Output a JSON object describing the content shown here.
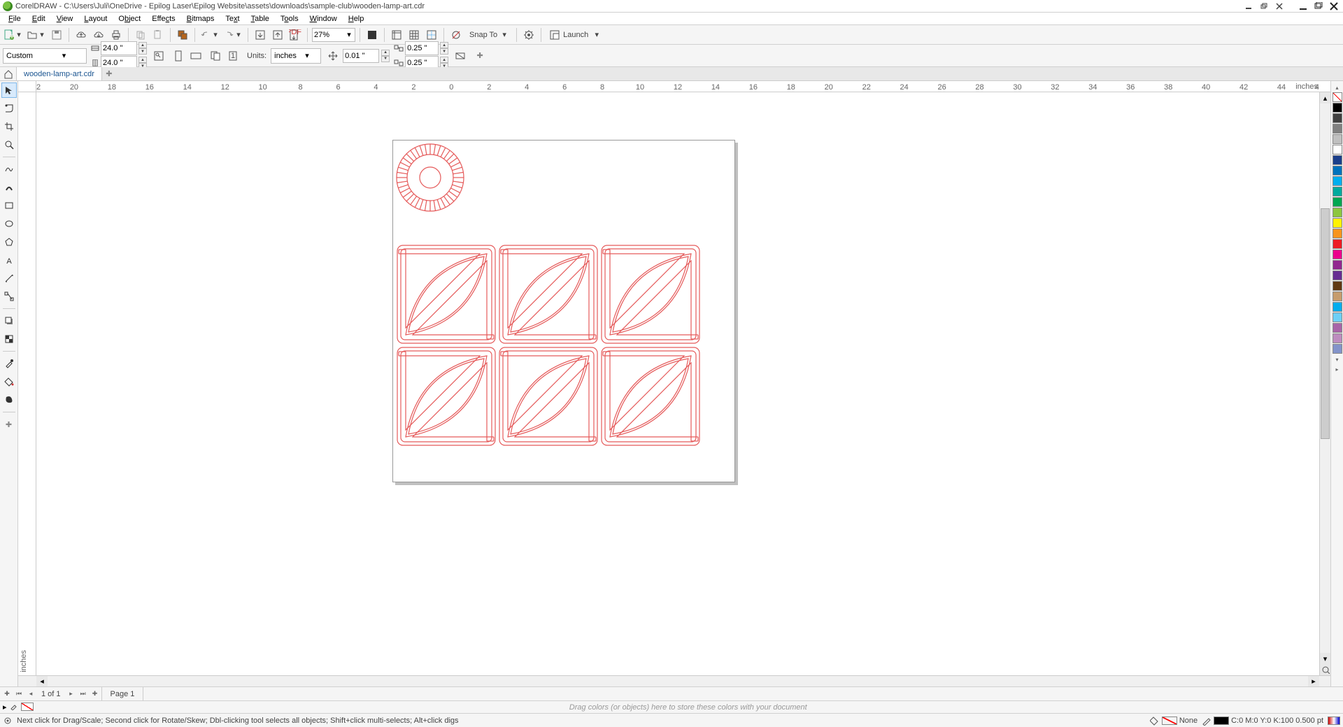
{
  "title": "CorelDRAW - C:\\Users\\Juli\\OneDrive - Epilog Laser\\Epilog Website\\assets\\downloads\\sample-club\\wooden-lamp-art.cdr",
  "menu": [
    "File",
    "Edit",
    "View",
    "Layout",
    "Object",
    "Effects",
    "Bitmaps",
    "Text",
    "Table",
    "Tools",
    "Window",
    "Help"
  ],
  "toolbar1": {
    "zoom": "27%",
    "snap": "Snap To",
    "launch": "Launch"
  },
  "toolbar2": {
    "preset": "Custom",
    "width": "24.0 \"",
    "height": "24.0 \"",
    "units_label": "Units:",
    "units": "inches",
    "nudge": "0.01 \"",
    "dupx": "0.25 \"",
    "dupy": "0.25 \""
  },
  "tab": "wooden-lamp-art.cdr",
  "ruler": {
    "unit": "inches",
    "min": -22,
    "max": 46,
    "step": 2
  },
  "ruler_v_unit": "inches",
  "pagenav": {
    "of": "1   of 1",
    "page": "Page 1"
  },
  "docpal_hint": "Drag colors (or objects) here to store these colors with your document",
  "status": {
    "hint": "Next click for Drag/Scale; Second click for Rotate/Skew; Dbl-clicking tool selects all objects; Shift+click multi-selects; Alt+click digs",
    "fill": "None",
    "outline": "C:0 M:0 Y:0 K:100  0.500 pt"
  },
  "palette": [
    "#000000",
    "#404040",
    "#808080",
    "#c0c0c0",
    "#ffffff",
    "#1b3f8b",
    "#0072bc",
    "#00aeef",
    "#00a99d",
    "#00a651",
    "#8dc63f",
    "#fff200",
    "#f7941d",
    "#ed1c24",
    "#ec008c",
    "#92278f",
    "#662d91",
    "#603913",
    "#c69c6d",
    "#00adee",
    "#6dcff6",
    "#a864a8",
    "#bd8cbf",
    "#8393ca"
  ]
}
